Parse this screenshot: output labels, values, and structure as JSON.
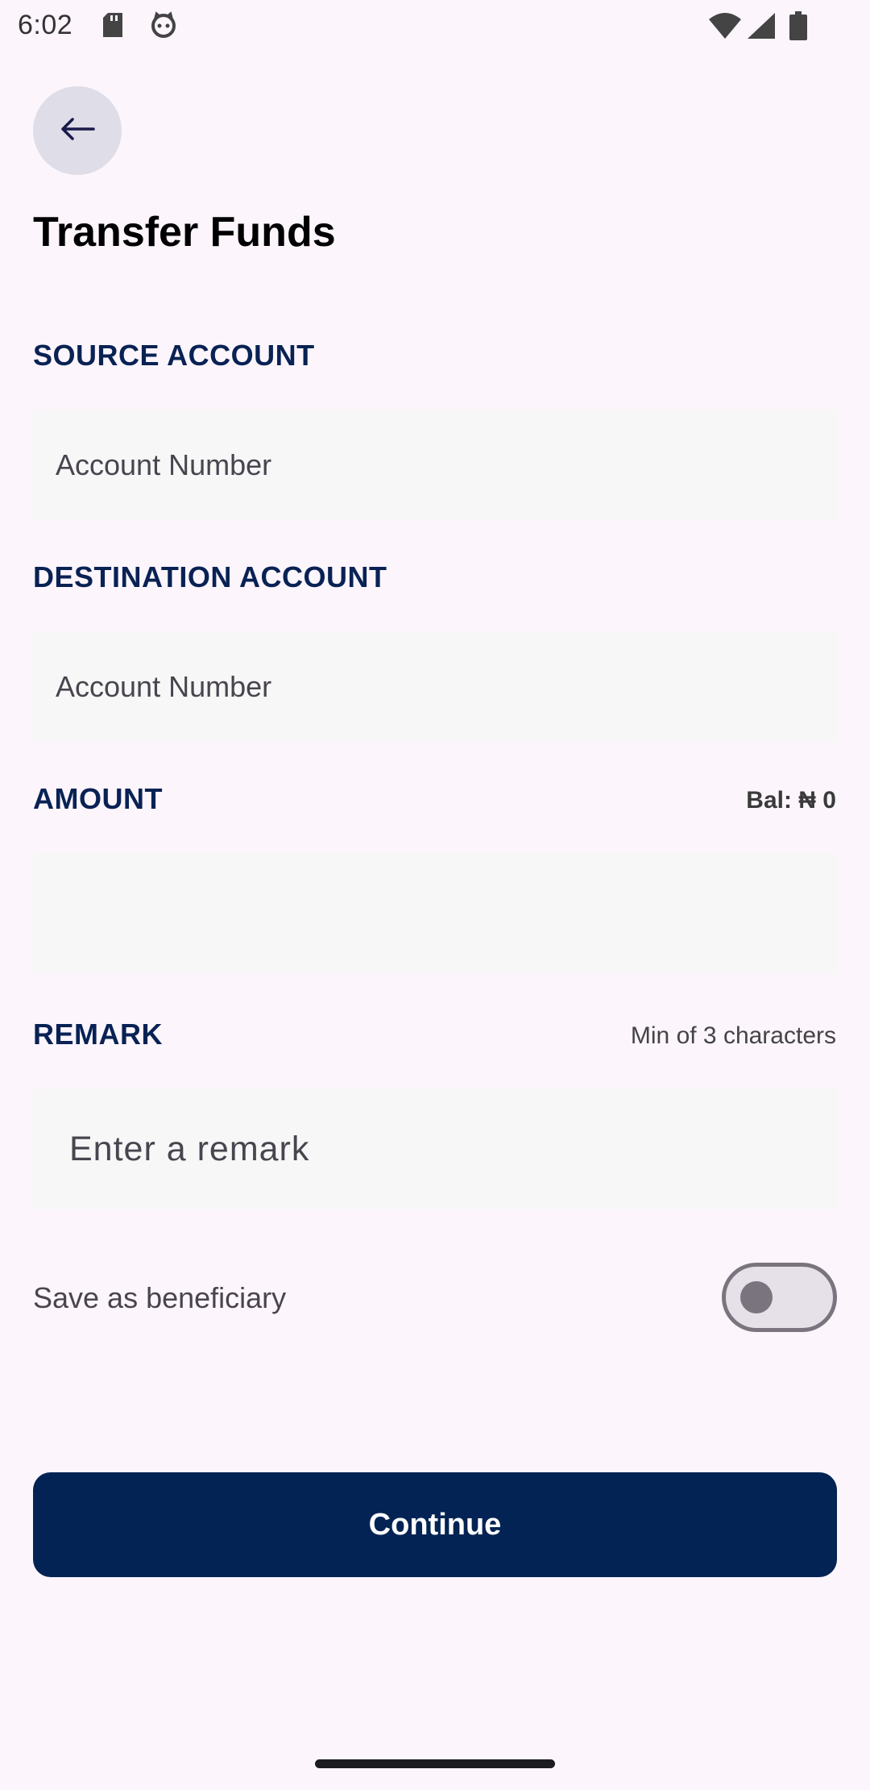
{
  "status_bar": {
    "time": "6:02",
    "icons": [
      "sd-card-icon",
      "cat-face-icon",
      "wifi-icon",
      "signal-icon",
      "battery-icon"
    ]
  },
  "header": {
    "back_icon": "arrow-left-icon",
    "title": "Transfer Funds"
  },
  "form": {
    "source": {
      "label": "SOURCE ACCOUNT",
      "placeholder": "Account Number",
      "value": ""
    },
    "destination": {
      "label": "DESTINATION ACCOUNT",
      "placeholder": "Account Number",
      "value": ""
    },
    "amount": {
      "label": "AMOUNT",
      "balance": "Bal: ₦ 0",
      "value": ""
    },
    "remark": {
      "label": "REMARK",
      "hint": "Min of 3 characters",
      "placeholder": "Enter a remark",
      "value": ""
    },
    "save_beneficiary": {
      "label": "Save as beneficiary",
      "checked": false
    }
  },
  "actions": {
    "continue_label": "Continue"
  },
  "colors": {
    "background": "#fcf5fc",
    "accent": "#022353",
    "label": "#092254",
    "input_bg": "#f7f7f7"
  }
}
